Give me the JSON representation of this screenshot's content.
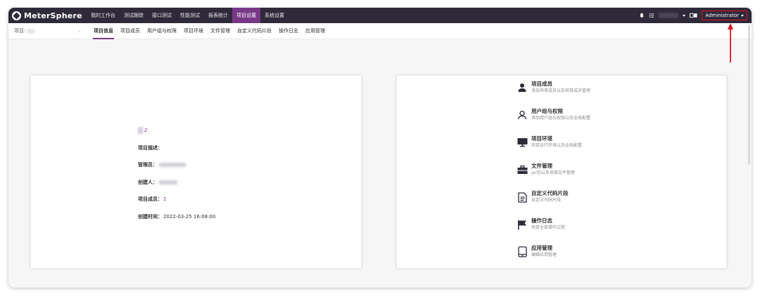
{
  "app": {
    "name": "MeterSphere"
  },
  "nav": {
    "items": [
      {
        "label": "我的工作台"
      },
      {
        "label": "测试跟踪"
      },
      {
        "label": "接口测试"
      },
      {
        "label": "性能测试"
      },
      {
        "label": "报表统计"
      },
      {
        "label": "项目设置"
      },
      {
        "label": "系统设置"
      }
    ],
    "active": "项目设置"
  },
  "header_right": {
    "user_label": "Administrator",
    "icons": [
      "bell-icon",
      "list-icon",
      "language-icon"
    ]
  },
  "subbar": {
    "project_label": "项目:",
    "tabs": [
      {
        "label": "项目信息"
      },
      {
        "label": "项目成员"
      },
      {
        "label": "用户组与权限"
      },
      {
        "label": "项目环境"
      },
      {
        "label": "文件管理"
      },
      {
        "label": "自定义代码片段"
      },
      {
        "label": "操作日志"
      },
      {
        "label": "应用管理"
      }
    ],
    "active_tab": "项目信息"
  },
  "project_info": {
    "name_suffix": "2",
    "desc_label": "项目描述：",
    "manager_label": "管理员：",
    "creator_label": "创建人：",
    "members_label": "项目成员：",
    "members_value": "2",
    "created_label": "创建时间：",
    "created_value": "2022-03-25 16:08:00"
  },
  "settings_menu": [
    {
      "title": "项目成员",
      "desc": "添加项目成员以及项目成员管理",
      "icon": "person-icon"
    },
    {
      "title": "用户组与权限",
      "desc": "添加用户组与权限以及全局配置",
      "icon": "user-outline-icon"
    },
    {
      "title": "项目环境",
      "desc": "项目运行环境以及全局配置",
      "icon": "monitor-icon"
    },
    {
      "title": "文件管理",
      "desc": "jar包以及资源文件管理",
      "icon": "briefcase-icon"
    },
    {
      "title": "自定义代码片段",
      "desc": "自定义代码片段",
      "icon": "document-icon"
    },
    {
      "title": "操作日志",
      "desc": "项目全部操作过程",
      "icon": "flag-icon"
    },
    {
      "title": "应用管理",
      "desc": "编辑应用管理",
      "icon": "tablet-icon"
    }
  ],
  "colors": {
    "topbar": "#2e2a39",
    "accent": "#783887",
    "highlight": "#e0131d"
  }
}
